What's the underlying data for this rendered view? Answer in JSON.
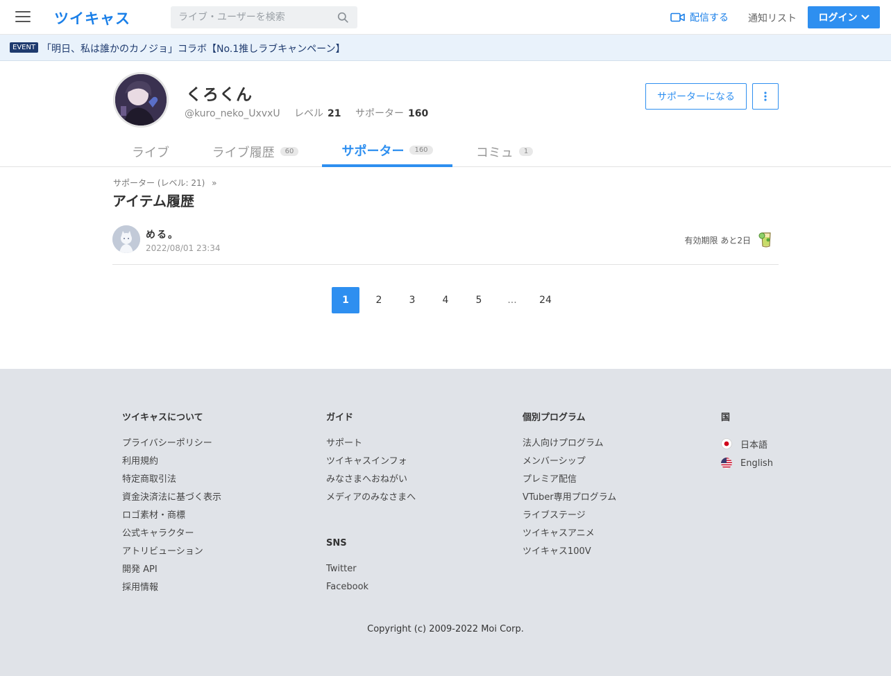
{
  "header": {
    "logo": "ツイキャス",
    "search_placeholder": "ライブ・ユーザーを検索",
    "broadcast_label": "配信する",
    "notify_label": "通知リスト",
    "login_label": "ログイン",
    "colors": {
      "brand": "#1a7fe8",
      "primary": "#2e8ff0"
    }
  },
  "event": {
    "badge": "EVENT",
    "text": "「明日、私は誰かのカノジョ」コラボ【No.1推しラブキャンペーン】"
  },
  "profile": {
    "name": "くろくん",
    "handle": "@kuro_neko_UxvxU",
    "level_label": "レベル",
    "level_value": "21",
    "supporter_label": "サポーター",
    "supporter_value": "160",
    "support_button": "サポーターになる"
  },
  "tabs": [
    {
      "label": "ライブ",
      "count": ""
    },
    {
      "label": "ライブ履歴",
      "count": "60"
    },
    {
      "label": "サポーター",
      "count": "160"
    },
    {
      "label": "コミュ",
      "count": "1"
    }
  ],
  "content": {
    "breadcrumb": "サポーター (レベル: 21)",
    "breadcrumb_sep": "»",
    "title": "アイテム履歴",
    "items": [
      {
        "name": "める。",
        "date": "2022/08/01 23:34",
        "expire": "有効期限 あと2日",
        "icon": "drink-item-icon"
      }
    ]
  },
  "pagination": {
    "pages": [
      "1",
      "2",
      "3",
      "4",
      "5",
      "...",
      "24"
    ],
    "current": "1"
  },
  "footer": {
    "col1": {
      "title": "ツイキャスについて",
      "links": [
        "プライバシーポリシー",
        "利用規約",
        "特定商取引法",
        "資金決済法に基づく表示",
        "ロゴ素材・商標",
        "公式キャラクター",
        "アトリビューション",
        "開発 API",
        "採用情報"
      ]
    },
    "col2": {
      "title": "ガイド",
      "links": [
        "サポート",
        "ツイキャスインフォ",
        "みなさまへおねがい",
        "メディアのみなさまへ"
      ],
      "sns_title": "SNS",
      "sns_links": [
        "Twitter",
        "Facebook"
      ]
    },
    "col3": {
      "title": "個別プログラム",
      "links": [
        "法人向けプログラム",
        "メンバーシップ",
        "プレミア配信",
        "VTuber専用プログラム",
        "ライブステージ",
        "ツイキャスアニメ",
        "ツイキャス100V"
      ]
    },
    "col4": {
      "title": "国",
      "langs": [
        "日本語",
        "English"
      ]
    },
    "copyright": "Copyright (c) 2009-2022 Moi Corp."
  }
}
